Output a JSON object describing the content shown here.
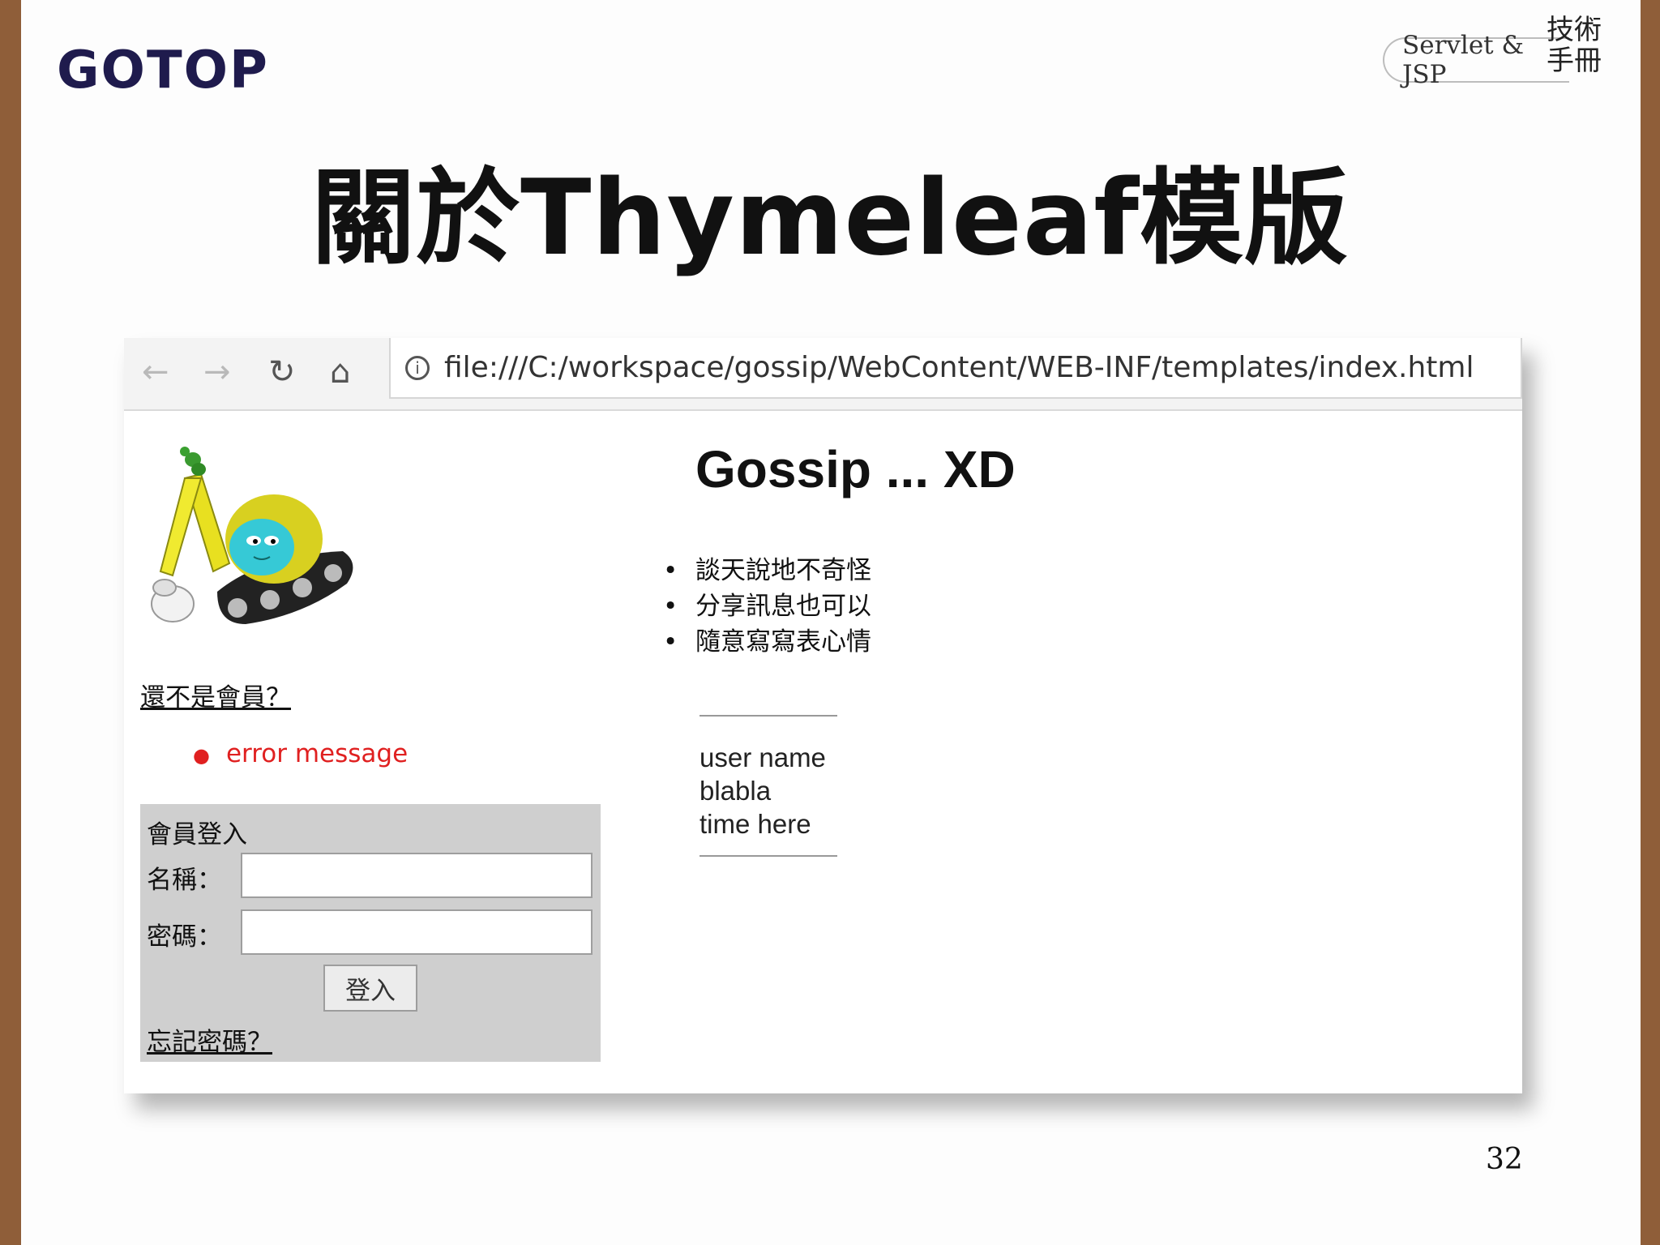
{
  "slide": {
    "logo": "GOTOP",
    "series_label": "Servlet & JSP",
    "series_calligraphy": "技術手冊",
    "title": "關於Thymeleaf模版",
    "page_number": "32"
  },
  "browser": {
    "back_icon": "←",
    "forward_icon": "→",
    "reload_icon": "↻",
    "home_icon": "⌂",
    "info_icon": "i",
    "url": "file:///C:/workspace/gossip/WebContent/WEB-INF/templates/index.html"
  },
  "page": {
    "register_link": "還不是會員？",
    "errors": [
      "error message"
    ],
    "login": {
      "heading": "會員登入",
      "name_label": "名稱：",
      "password_label": "密碼：",
      "button": "登入",
      "forgot_link": "忘記密碼？"
    },
    "site_title": "Gossip ... XD",
    "features": [
      "談天說地不奇怪",
      "分享訊息也可以",
      "隨意寫寫表心情"
    ],
    "message": {
      "user": "user name",
      "text": "blabla",
      "time": "time here"
    }
  },
  "colors": {
    "frame_brown": "#8f5e39",
    "logo_navy": "#1f1b4d",
    "error_red": "#e02020",
    "login_box_gray": "#cfcfcf"
  }
}
